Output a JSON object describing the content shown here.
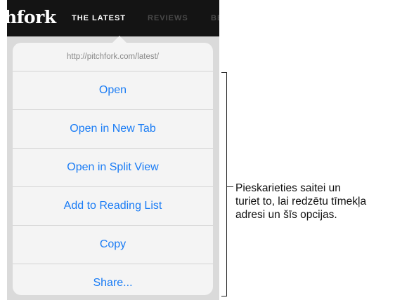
{
  "navbar": {
    "logo_text": "hfork",
    "items": [
      {
        "label": "THE LATEST"
      },
      {
        "label": "REVIEWS"
      },
      {
        "label": "BE"
      }
    ]
  },
  "popover": {
    "url": "http://pitchfork.com/latest/",
    "items": [
      {
        "label": "Open"
      },
      {
        "label": "Open in New Tab"
      },
      {
        "label": "Open in Split View"
      },
      {
        "label": "Add to Reading List"
      },
      {
        "label": "Copy"
      },
      {
        "label": "Share..."
      }
    ]
  },
  "callout": {
    "lines": [
      "Pieskarieties saitei un",
      "turiet to, lai redzētu tīmekļa",
      "adresi un šīs opcijas."
    ]
  },
  "colors": {
    "navbar_bg": "#141414",
    "menu_bg": "#f4f4f4",
    "link_blue": "#1a7cf5",
    "url_gray": "#8a8a8a"
  }
}
